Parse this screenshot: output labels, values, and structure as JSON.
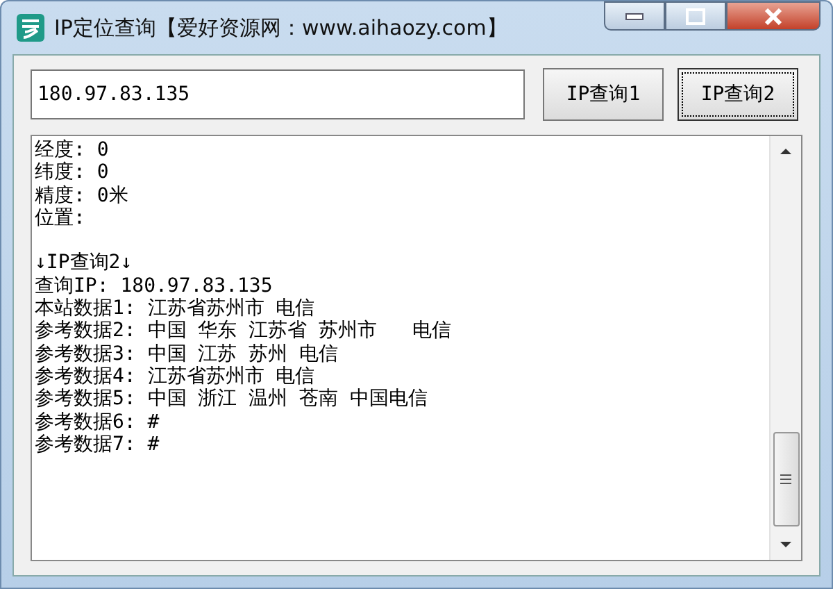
{
  "window": {
    "title": "IP定位查询【爱好资源网：www.aihaozy.com】"
  },
  "ip_field": {
    "value": "180.97.83.135"
  },
  "buttons": [
    {
      "label": "IP查询1",
      "focused": false
    },
    {
      "label": "IP查询2",
      "focused": true
    }
  ],
  "output": {
    "sections": [
      [
        "经度: 0",
        "纬度: 0",
        "精度: 0米",
        "位置:"
      ],
      [
        "↓IP查询2↓",
        "查询IP: 180.97.83.135",
        "本站数据1: 江苏省苏州市 电信",
        "参考数据2: 中国 华东 江苏省 苏州市   电信",
        "参考数据3: 中国 江苏 苏州 电信",
        "参考数据4: 江苏省苏州市 电信",
        "参考数据5: 中国 浙江 温州 苍南 中国电信",
        "参考数据6: #",
        "参考数据7: #"
      ]
    ]
  }
}
